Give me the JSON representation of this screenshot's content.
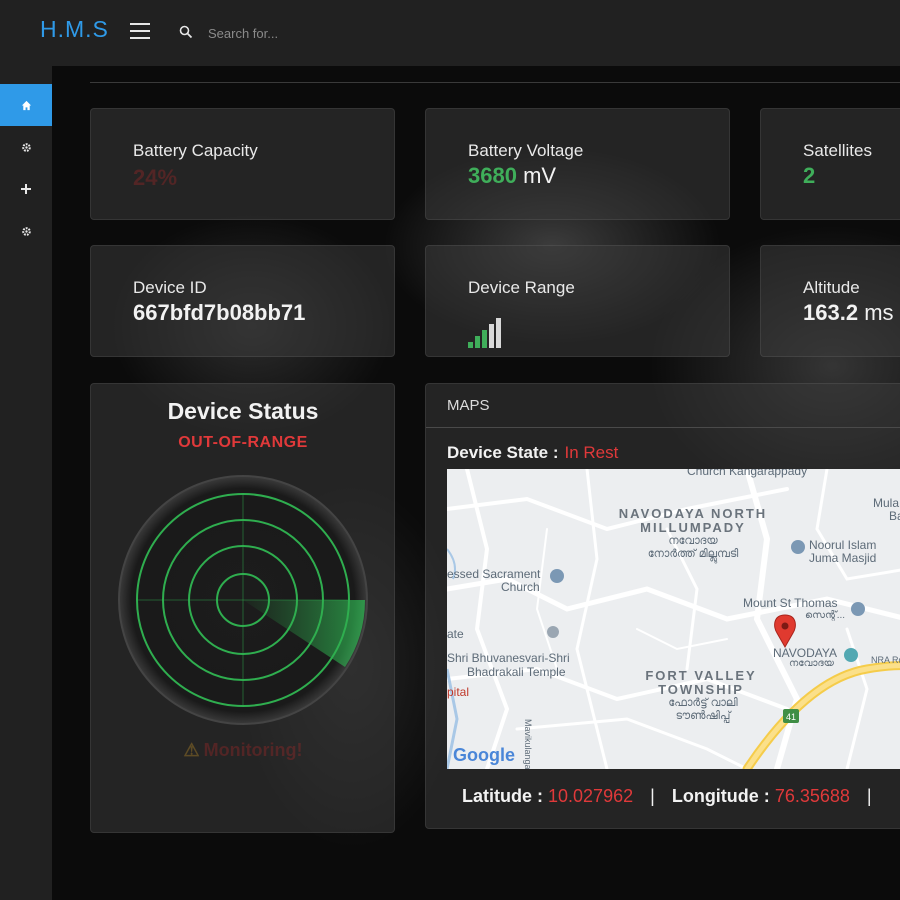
{
  "app": {
    "brand": "H.M.S"
  },
  "search": {
    "placeholder": "Search for..."
  },
  "sidebar": {
    "items": [
      {
        "icon": "home-icon"
      },
      {
        "icon": "gear-icon"
      },
      {
        "icon": "plus-icon"
      },
      {
        "icon": "gear-icon"
      }
    ]
  },
  "cards": {
    "battery_capacity": {
      "label": "Battery Capacity",
      "value": "24%"
    },
    "battery_voltage": {
      "label": "Battery Voltage",
      "value": "3680",
      "unit": "mV"
    },
    "satellites": {
      "label": "Satellites",
      "value": "2"
    },
    "device_id": {
      "label": "Device ID",
      "value": "667bfd7b08bb71"
    },
    "device_range": {
      "label": "Device Range",
      "level": 0.6
    },
    "altitude": {
      "label": "Altitude",
      "value": "163.2",
      "unit": "ms"
    }
  },
  "status": {
    "title": "Device Status",
    "value": "OUT-OF-RANGE",
    "monitoring": "Monitoring!"
  },
  "maps": {
    "header": "MAPS",
    "state_label": "Device State :",
    "state_value": "In Rest",
    "latitude_label": "Latitude :",
    "latitude_value": "10.027962",
    "longitude_label": "Longitude :",
    "longitude_value": "76.35688",
    "separator": "|",
    "labels": {
      "church_top": "Church Kangarappady",
      "navodaya_north_1": "NAVODAYA NORTH",
      "navodaya_north_2": "MILLUMPADY",
      "navodaya_north_ml": "നവോദയ നോർത്ത് മില്ലുമ്പടി",
      "noorul_1": "Noorul Islam",
      "noorul_2": "Juma Masjid",
      "mula": "Mula",
      "ba": "Ba",
      "sacrament_1": "essed Sacrament",
      "sacrament_2": "Church",
      "mount_1": "Mount St Thomas",
      "mount_ml": "സെന്റ്...",
      "ate": "ate",
      "temple_1": "Shri Bhuvanesvari-Shri",
      "temple_2": "Bhadrakali Temple",
      "navodaya": "NAVODAYA",
      "navodaya_ml": "നവോദയ",
      "nra": "NRA Rd",
      "fort_1": "FORT VALLEY",
      "fort_2": "TOWNSHIP",
      "fort_ml": "ഫോർട്ട് വാലി ടൗൺഷിപ്പ്",
      "pital": "pital",
      "road_41": "41",
      "mavikulangara": "Mavikulangara Rd",
      "google": "Google"
    }
  },
  "colors": {
    "accent": "#2f9ae8",
    "green": "#3fae5a",
    "red": "#e0393a"
  }
}
